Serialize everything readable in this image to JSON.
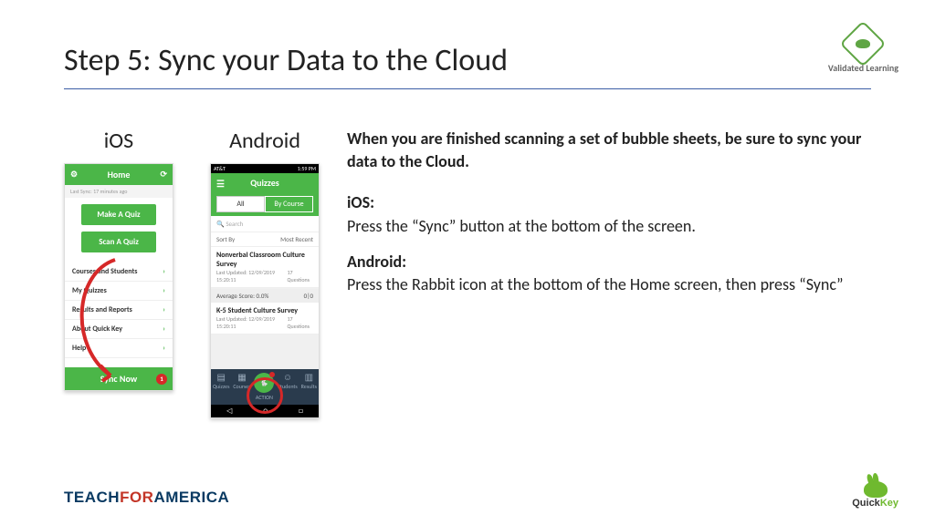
{
  "header": {
    "title": "Step 5: Sync your Data to the Cloud",
    "vl_label": "Validated Learning"
  },
  "platforms": {
    "ios_label": "iOS",
    "android_label": "Android"
  },
  "ios_screen": {
    "title": "Home",
    "last_sync": "Last Sync: 17 minutes ago",
    "make_quiz": "Make A Quiz",
    "scan_quiz": "Scan A Quiz",
    "menu": {
      "courses": "Courses and Students",
      "my_quizzes": "My Quizzes",
      "results": "Results and Reports",
      "about": "About Quick Key",
      "help": "Help"
    },
    "sync_now": "Sync Now",
    "badge": "1"
  },
  "android_screen": {
    "carrier": "AT&T",
    "time": "1:59 PM",
    "title": "Quizzes",
    "tab_all": "All",
    "tab_course": "By Course",
    "search_placeholder": "Search",
    "sort_label": "Sort By",
    "sort_value": "Most Recent",
    "items": [
      {
        "title": "Nonverbal Classroom Culture Survey",
        "q": "17 Questions",
        "updated": "Last Updated:",
        "date": "12/09/2019 15:20:11"
      },
      {
        "title": "K-5 Student Culture Survey",
        "q": "17 Questions",
        "updated": "Last Updated:",
        "date": "12/09/2019 15:20:11"
      }
    ],
    "avg_label": "Average Score: 0.0%",
    "avg_val": "0|0",
    "nav": {
      "quizzes": "Quizzes",
      "courses": "Courses",
      "action": "ACTION",
      "students": "Students",
      "results": "Results"
    }
  },
  "instructions": {
    "intro": "When you are finished scanning a set of bubble sheets, be sure to sync your data to the Cloud.",
    "ios_head": "iOS:",
    "ios_body": "Press the “Sync” button at the bottom of the screen.",
    "and_head": "Android:",
    "and_body": "Press the Rabbit icon at the bottom of the Home screen, then press “Sync”"
  },
  "footer": {
    "tfa1": "TEACH",
    "tfa2": "FOR",
    "tfa3": "AMERICA",
    "qk1": "Quick",
    "qk2": "Key"
  }
}
